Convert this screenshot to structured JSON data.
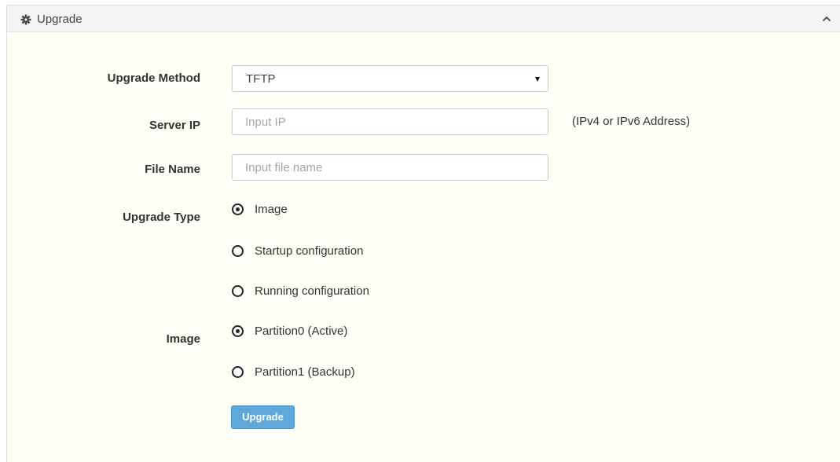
{
  "panel": {
    "title": "Upgrade",
    "icon": "gear-icon",
    "collapse_icon": "chevron-up-icon"
  },
  "form": {
    "upgrade_method": {
      "label": "Upgrade Method",
      "value": "TFTP"
    },
    "server_ip": {
      "label": "Server IP",
      "placeholder": "Input IP",
      "value": "",
      "hint": "(IPv4 or IPv6 Address)"
    },
    "file_name": {
      "label": "File Name",
      "placeholder": "Input file name",
      "value": ""
    },
    "upgrade_type": {
      "label": "Upgrade Type",
      "options": [
        {
          "label": "Image",
          "checked": true
        },
        {
          "label": "Startup configuration",
          "checked": false
        },
        {
          "label": "Running configuration",
          "checked": false
        }
      ]
    },
    "image": {
      "label": "Image",
      "options": [
        {
          "label": "Partition0 (Active)",
          "checked": true
        },
        {
          "label": "Partition1 (Backup)",
          "checked": false
        }
      ]
    },
    "submit_label": "Upgrade"
  },
  "colors": {
    "button": "#5fa8db",
    "panel_background": "#fffef7",
    "header_background": "#f4f4f4"
  }
}
